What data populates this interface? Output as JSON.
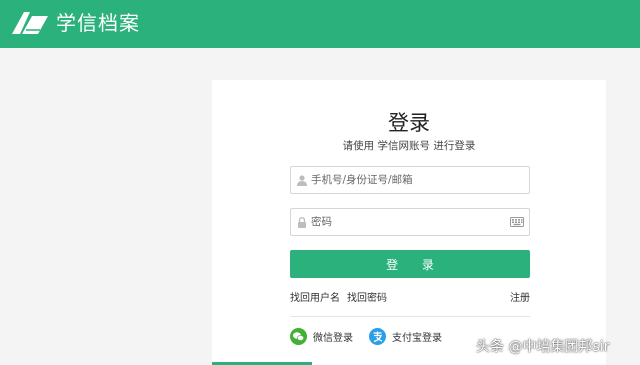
{
  "header": {
    "site_name": "学信档案"
  },
  "login": {
    "title": "登录",
    "subtitle": "请使用 学信网账号 进行登录",
    "username_placeholder": "手机号/身份证号/邮箱",
    "password_placeholder": "密码",
    "submit_label": "登 录",
    "forgot_username": "找回用户名",
    "forgot_password": "找回密码",
    "register": "注册",
    "wechat_login": "微信登录",
    "alipay_login": "支付宝登录"
  },
  "watermark": {
    "text": "头条 @中培集团邦sir"
  },
  "colors": {
    "brand": "#2bb17c",
    "wechat": "#41b035",
    "alipay": "#2a9fe8"
  }
}
